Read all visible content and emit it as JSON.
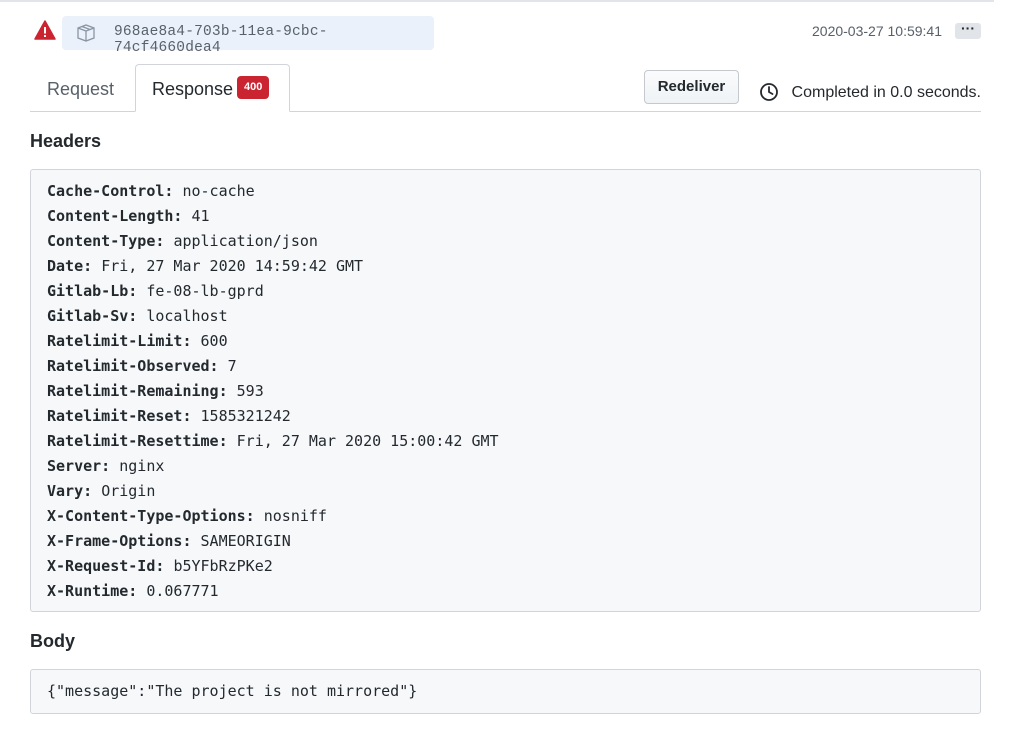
{
  "delivery": {
    "status_icon": "alert-icon",
    "status_color": "#cb2431",
    "package_icon": "package-icon",
    "guid": "968ae8a4-703b-11ea-9cbc-74cf4660dea4",
    "timestamp": "2020-03-27 10:59:41",
    "more_label": "···"
  },
  "tabs": {
    "request_label": "Request",
    "response_label": "Response",
    "response_badge": "400"
  },
  "actions": {
    "redeliver_label": "Redeliver",
    "clock_icon": "clock-icon",
    "completed_text": "Completed in 0.0 seconds."
  },
  "headers": {
    "title": "Headers",
    "items": [
      {
        "key": "Cache-Control:",
        "value": "no-cache"
      },
      {
        "key": "Content-Length:",
        "value": "41"
      },
      {
        "key": "Content-Type:",
        "value": "application/json"
      },
      {
        "key": "Date:",
        "value": "Fri, 27 Mar 2020 14:59:42 GMT"
      },
      {
        "key": "Gitlab-Lb:",
        "value": "fe-08-lb-gprd"
      },
      {
        "key": "Gitlab-Sv:",
        "value": "localhost"
      },
      {
        "key": "Ratelimit-Limit:",
        "value": "600"
      },
      {
        "key": "Ratelimit-Observed:",
        "value": "7"
      },
      {
        "key": "Ratelimit-Remaining:",
        "value": "593"
      },
      {
        "key": "Ratelimit-Reset:",
        "value": "1585321242"
      },
      {
        "key": "Ratelimit-Resettime:",
        "value": "Fri, 27 Mar 2020 15:00:42 GMT"
      },
      {
        "key": "Server:",
        "value": "nginx"
      },
      {
        "key": "Vary:",
        "value": "Origin"
      },
      {
        "key": "X-Content-Type-Options:",
        "value": "nosniff"
      },
      {
        "key": "X-Frame-Options:",
        "value": "SAMEORIGIN"
      },
      {
        "key": "X-Request-Id:",
        "value": "b5YFbRzPKe2"
      },
      {
        "key": "X-Runtime:",
        "value": "0.067771"
      }
    ]
  },
  "body": {
    "title": "Body",
    "content": "{\"message\":\"The project is not mirrored\"}"
  }
}
